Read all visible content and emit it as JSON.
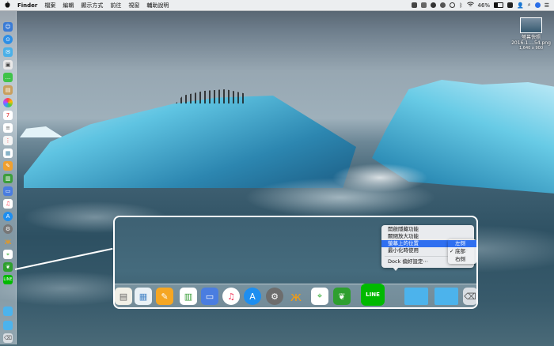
{
  "menubar": {
    "apple": "",
    "items": [
      "Finder",
      "檔案",
      "編輯",
      "顯示方式",
      "前往",
      "視窗",
      "輔助說明"
    ],
    "battery": "46%"
  },
  "desktop_file": {
    "title": "螢幕快照",
    "name": "2016-1....54.png",
    "dimensions": "1,640 x 900"
  },
  "context_menu": {
    "items": [
      "開啟隱藏功能",
      "關閉放大功能",
      "螢幕上的位置",
      "最小化時使用",
      "Dock 偏好設定⋯"
    ],
    "highlighted": "螢幕上的位置",
    "submenu": [
      "左側",
      "底部",
      "右側"
    ],
    "submenu_highlighted": "左側",
    "submenu_checked": "底部"
  },
  "dock_icons": [
    "contacts-icon",
    "preview-icon",
    "pages-icon",
    "numbers-icon",
    "keynote-icon",
    "itunes-icon",
    "app-store-icon",
    "system-preferences-icon",
    "tes-icon",
    "maps-icon",
    "evernote-icon",
    "line-icon",
    "folder-icon",
    "folder-icon",
    "trash-icon"
  ],
  "line_label": "LINE",
  "colors": {
    "highlight": "#2f6ff0",
    "menu_bg": "#eef0f2"
  }
}
